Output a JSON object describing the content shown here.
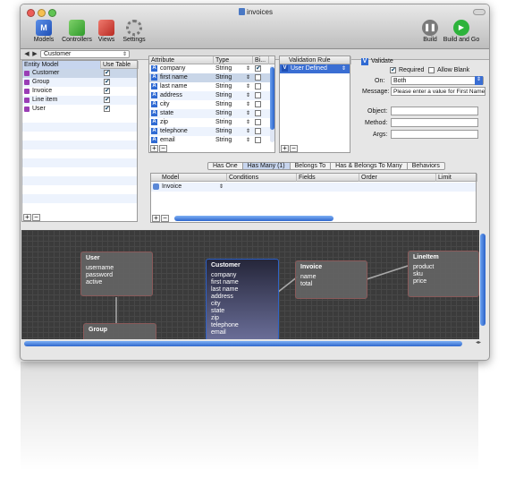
{
  "window": {
    "title": "invoices"
  },
  "toolbar": {
    "left": [
      {
        "label": "Models",
        "icon": "models-cube-icon"
      },
      {
        "label": "Controllers",
        "icon": "controllers-cube-icon"
      },
      {
        "label": "Views",
        "icon": "views-cube-icon"
      },
      {
        "label": "Settings",
        "icon": "settings-gear-icon"
      }
    ],
    "right": [
      {
        "label": "Build",
        "icon": "pause-icon"
      },
      {
        "label": "Build and Go",
        "icon": "play-icon"
      }
    ]
  },
  "navbar": {
    "back": "◀",
    "forward": "▶",
    "selected": "Customer"
  },
  "entities": {
    "headers": [
      "Entity Model",
      "Use Table"
    ],
    "rows": [
      {
        "name": "Customer",
        "checked": "✔"
      },
      {
        "name": "Group",
        "checked": "✔"
      },
      {
        "name": "Invoice",
        "checked": "✔"
      },
      {
        "name": "Line item",
        "checked": "✔"
      },
      {
        "name": "User",
        "checked": "✔"
      }
    ]
  },
  "attributes": {
    "headers": [
      "Attribute",
      "Type",
      "Bi..."
    ],
    "rows": [
      {
        "name": "company",
        "type": "String",
        "checked": "✔"
      },
      {
        "name": "first name",
        "type": "String",
        "checked": ""
      },
      {
        "name": "last name",
        "type": "String",
        "checked": ""
      },
      {
        "name": "address",
        "type": "String",
        "checked": ""
      },
      {
        "name": "city",
        "type": "String",
        "checked": ""
      },
      {
        "name": "state",
        "type": "String",
        "checked": ""
      },
      {
        "name": "zip",
        "type": "String",
        "checked": ""
      },
      {
        "name": "telephone",
        "type": "String",
        "checked": ""
      },
      {
        "name": "email",
        "type": "String",
        "checked": ""
      }
    ]
  },
  "validation": {
    "header": "Validation Rule",
    "rows": [
      {
        "badge": "V",
        "name": "User Defined"
      }
    ],
    "validate_badge": "V",
    "validate_label": "Validate",
    "required_label": "Required",
    "required_check": "✔",
    "allow_blank_label": "Allow Blank",
    "on_label": "On:",
    "on_value": "Both",
    "message_label": "Message:",
    "message_value": "Please enter a value for First Name",
    "object_label": "Object:",
    "method_label": "Method:",
    "args_label": "Args:"
  },
  "relations": {
    "tabs": [
      "Has One",
      "Has Many (1)",
      "Belongs To",
      "Has & Belongs To Many",
      "Behaviors"
    ],
    "headers": [
      "Model",
      "Conditions",
      "Fields",
      "Order",
      "Limit"
    ],
    "rows": [
      {
        "model": "Invoice"
      }
    ]
  },
  "diagram": {
    "nodes": [
      {
        "title": "User",
        "fields": [
          "username",
          "password",
          "active"
        ]
      },
      {
        "title": "Customer",
        "fields": [
          "company",
          "first name",
          "last name",
          "address",
          "city",
          "state",
          "zip",
          "telephone",
          "email"
        ]
      },
      {
        "title": "Invoice",
        "fields": [
          "name",
          "total"
        ]
      },
      {
        "title": "LineItem",
        "fields": [
          "product",
          "sku",
          "price"
        ]
      },
      {
        "title": "Group",
        "fields": []
      }
    ]
  },
  "colors": {
    "accent": "#2f63c8",
    "entity": "#9a3db5",
    "canvas": "#3b3b3b"
  }
}
